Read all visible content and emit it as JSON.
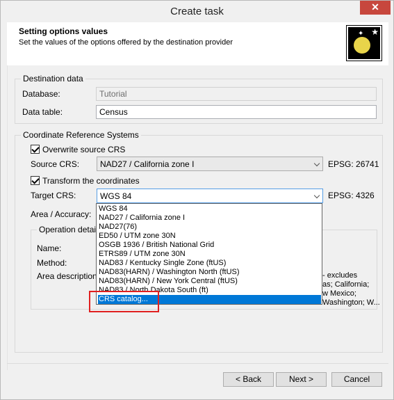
{
  "window": {
    "title": "Create task",
    "close_glyph": "✕"
  },
  "header": {
    "title": "Setting options values",
    "subtitle": "Set the values of the options offered by the destination provider"
  },
  "destination": {
    "group_label": "Destination data",
    "database_label": "Database:",
    "database_value": "Tutorial",
    "table_label": "Data table:",
    "table_value": "Census"
  },
  "crs": {
    "group_label": "Coordinate Reference Systems",
    "overwrite_label": "Overwrite source CRS",
    "overwrite_checked": true,
    "source_label": "Source CRS:",
    "source_value": "NAD27 / California zone I",
    "source_epsg": "EPSG: 26741",
    "transform_label": "Transform the coordinates",
    "transform_checked": true,
    "target_label": "Target CRS:",
    "target_value": "WGS 84",
    "target_epsg": "EPSG: 4326",
    "area_label": "Area / Accuracy:"
  },
  "dropdown": {
    "items": [
      "WGS 84",
      "NAD27 / California zone I",
      "NAD27(76)",
      "ED50 / UTM zone 30N",
      "OSGB 1936 / British National Grid",
      "ETRS89 / UTM zone 30N",
      "NAD83 / Kentucky Single Zone (ftUS)",
      "NAD83(HARN) / Washington North (ftUS)",
      "NAD83(HARN) / New York Central (ftUS)",
      "NAD83 / North Dakota South (ft)",
      "CRS catalog..."
    ],
    "selected_index": 10
  },
  "operation": {
    "group_label": "Operation details",
    "name_label": "Name:",
    "method_label": "Method:",
    "area_label": "Area description:",
    "area_text_lines": [
      "- excludes",
      "as; California;",
      "w Mexico;",
      "Washington; W..."
    ]
  },
  "buttons": {
    "back": "< Back",
    "next": "Next >",
    "cancel": "Cancel"
  },
  "colors": {
    "selection": "#0078d7",
    "close": "#c7473d",
    "annotation": "#e02020"
  },
  "icons": {
    "logo": "wizard-logo-icon",
    "dropdown_chevron": "chevron-down-icon"
  }
}
